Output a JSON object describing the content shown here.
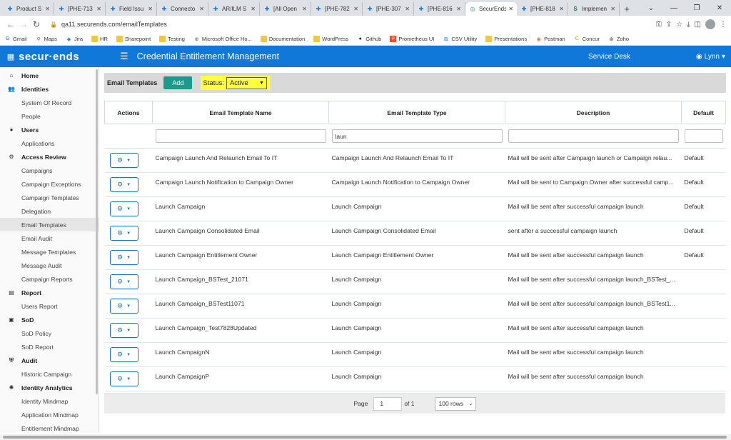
{
  "browser": {
    "tabs": [
      {
        "label": "Product S",
        "icon": "jira-icon"
      },
      {
        "label": "[PHE-713",
        "icon": "jira-icon"
      },
      {
        "label": "Field Issu",
        "icon": "jira-icon"
      },
      {
        "label": "Connecto",
        "icon": "jira-icon"
      },
      {
        "label": "AR/ILM S",
        "icon": "jira-icon"
      },
      {
        "label": "[All Open",
        "icon": "jira-icon"
      },
      {
        "label": "[PHE-782",
        "icon": "jira-icon"
      },
      {
        "label": "[PHE-307",
        "icon": "jira-icon"
      },
      {
        "label": "[PHE-816",
        "icon": "jira-icon"
      },
      {
        "label": "SecurEnds",
        "icon": "securends-icon",
        "active": true
      },
      {
        "label": "[PHE-818",
        "icon": "jira-icon"
      },
      {
        "label": "Implemen",
        "icon": "sharepoint-icon"
      }
    ],
    "url": "qa11.securends.com/emailTemplates",
    "bookmarks": [
      {
        "label": "Gmail",
        "icon": "google-icon"
      },
      {
        "label": "Maps",
        "icon": "maps-icon"
      },
      {
        "label": "Jira",
        "icon": "jira-icon"
      },
      {
        "label": "HR",
        "icon": "folder-icon"
      },
      {
        "label": "Sharepoint",
        "icon": "folder-icon"
      },
      {
        "label": "Testing",
        "icon": "folder-icon"
      },
      {
        "label": "Microsoft Office Ho...",
        "icon": "globe-icon"
      },
      {
        "label": "Documentation",
        "icon": "folder-icon"
      },
      {
        "label": "WordPress",
        "icon": "folder-icon"
      },
      {
        "label": "Github",
        "icon": "github-icon"
      },
      {
        "label": "Prometheus UI",
        "icon": "prometheus-icon"
      },
      {
        "label": "CSV Utility",
        "icon": "csv-icon"
      },
      {
        "label": "Presentations",
        "icon": "folder-icon"
      },
      {
        "label": "Postman",
        "icon": "postman-icon"
      },
      {
        "label": "Concur",
        "icon": "concur-icon"
      },
      {
        "label": "Zoho",
        "icon": "zoho-icon"
      }
    ]
  },
  "header": {
    "logo": "secur·ends",
    "title": "Credential Entitlement Management",
    "service_desk": "Service Desk",
    "user": "Lynn"
  },
  "sidebar": [
    {
      "type": "section",
      "label": "Home",
      "icon": "home-icon"
    },
    {
      "type": "section",
      "label": "Identities",
      "icon": "users-icon"
    },
    {
      "type": "item",
      "label": "System Of Record"
    },
    {
      "type": "item",
      "label": "People"
    },
    {
      "type": "section",
      "label": "Users",
      "icon": "user-icon"
    },
    {
      "type": "item",
      "label": "Applications"
    },
    {
      "type": "section",
      "label": "Access Review",
      "icon": "gears-icon"
    },
    {
      "type": "item",
      "label": "Campaigns"
    },
    {
      "type": "item",
      "label": "Campaign Exceptions"
    },
    {
      "type": "item",
      "label": "Campaign Templates"
    },
    {
      "type": "item",
      "label": "Delegation"
    },
    {
      "type": "item",
      "label": "Email Templates",
      "active": true
    },
    {
      "type": "item",
      "label": "Email Audit"
    },
    {
      "type": "item",
      "label": "Message Templates"
    },
    {
      "type": "item",
      "label": "Message Audit"
    },
    {
      "type": "item",
      "label": "Campaign Reports"
    },
    {
      "type": "section",
      "label": "Report",
      "icon": "report-icon"
    },
    {
      "type": "item",
      "label": "Users Report"
    },
    {
      "type": "section",
      "label": "SoD",
      "icon": "sod-icon"
    },
    {
      "type": "item",
      "label": "SoD Policy"
    },
    {
      "type": "item",
      "label": "SoD Report"
    },
    {
      "type": "section",
      "label": "Audit",
      "icon": "shield-icon"
    },
    {
      "type": "item",
      "label": "Historic Campaign"
    },
    {
      "type": "section",
      "label": "Identity Analytics",
      "icon": "analytics-icon"
    },
    {
      "type": "item",
      "label": "Identity Mindmap"
    },
    {
      "type": "item",
      "label": "Application Mindmap"
    },
    {
      "type": "item",
      "label": "Entitlement Mindmap"
    }
  ],
  "toolbar": {
    "title": "Email Templates",
    "add_label": "Add",
    "status_label": "Status:",
    "status_value": "Active"
  },
  "table": {
    "columns": [
      "Actions",
      "Email Template Name",
      "Email Template Type",
      "Description",
      "Default"
    ],
    "filters": {
      "name": "",
      "type": "laun",
      "description": "",
      "default": ""
    },
    "rows": [
      {
        "name": "Campaign Launch And Relaunch Email To IT",
        "type": "Campaign Launch And Relaunch Email To IT",
        "description": "Mail will be sent after Campaign launch or Campaign relau...",
        "default": "Default"
      },
      {
        "name": "Campaign Launch Notification to Campaign Owner",
        "type": "Campaign Launch Notification to Campaign Owner",
        "description": "Mail will be sent to Campaign Owner after successful camp...",
        "default": "Default"
      },
      {
        "name": "Launch Campaign",
        "type": "Launch Campaign",
        "description": "Mail will be sent after successful campaign launch",
        "default": "Default"
      },
      {
        "name": "Launch Campaign Consolidated Email",
        "type": "Launch Campaign Consolidated Email",
        "description": "sent after a successful campaign launch",
        "default": "Default"
      },
      {
        "name": "Launch Campaign Entitlement Owner",
        "type": "Launch Campaign Entitlement Owner",
        "description": "Mail will be sent after successful campaign launch",
        "default": "Default"
      },
      {
        "name": "Launch Campaign_BSTest_21071",
        "type": "Launch Campaign",
        "description": "Mail will be sent after successful campaign launch_BSTest_...",
        "default": ""
      },
      {
        "name": "Launch Campaign_BSTest11071",
        "type": "Launch Campaign",
        "description": "Mail will be sent after successful campaign launch_BSTest1...",
        "default": ""
      },
      {
        "name": "Launch Campaign_Test7828Updated",
        "type": "Launch Campaign",
        "description": "Mail will be sent after successful campaign launch",
        "default": ""
      },
      {
        "name": "Launch CampaignN",
        "type": "Launch Campaign",
        "description": "Mail will be sent after successful campaign launch",
        "default": ""
      },
      {
        "name": "Launch CampaignP",
        "type": "Launch Campaign",
        "description": "Mail will be sent after successful campaign launch",
        "default": ""
      }
    ]
  },
  "pager": {
    "page_label": "Page",
    "page": "1",
    "of_label": "of 1",
    "rows_option": "100 rows"
  },
  "colors": {
    "header_bg": "#0f78d8",
    "add_button": "#1b9b8a",
    "status_highlight": "#ffff3b"
  }
}
